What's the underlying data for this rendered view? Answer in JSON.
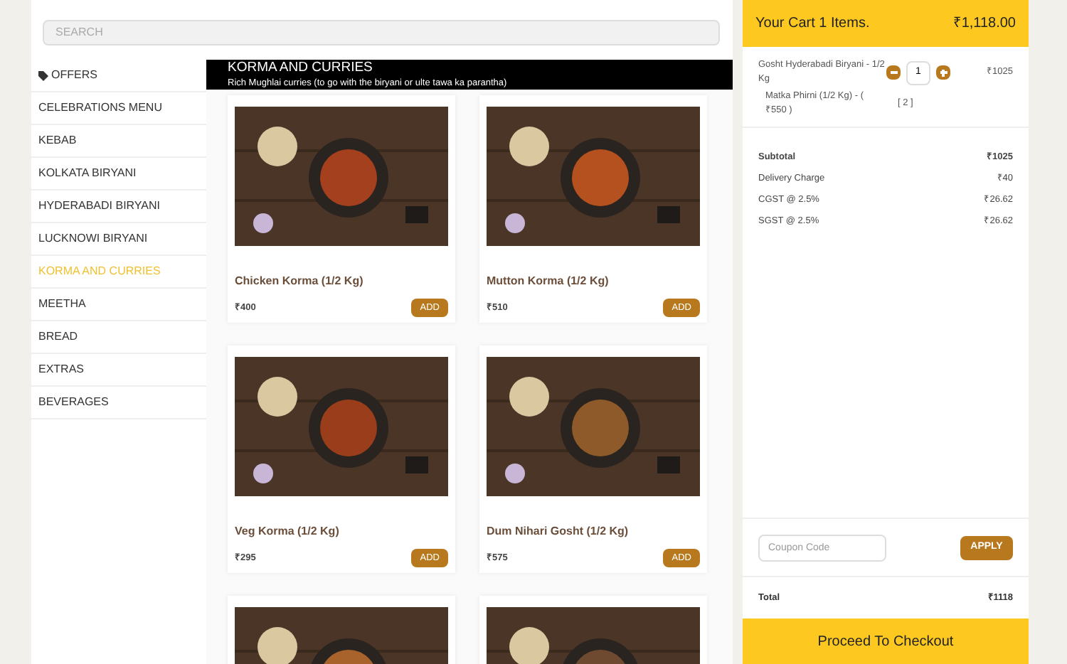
{
  "search": {
    "placeholder": "SEARCH"
  },
  "sidebar": {
    "items": [
      {
        "label": "OFFERS",
        "kind": "tag",
        "selected": false
      },
      {
        "label": "CELEBRATIONS MENU",
        "kind": "plain",
        "selected": false
      },
      {
        "label": "KEBAB",
        "kind": "plain",
        "selected": false
      },
      {
        "label": "KOLKATA BIRYANI",
        "kind": "plain",
        "selected": false
      },
      {
        "label": "HYDERABADI BIRYANI",
        "kind": "plain",
        "selected": false
      },
      {
        "label": "LUCKNOWI BIRYANI",
        "kind": "plain",
        "selected": false
      },
      {
        "label": "KORMA AND CURRIES",
        "kind": "plain",
        "selected": true
      },
      {
        "label": "MEETHA",
        "kind": "plain",
        "selected": false
      },
      {
        "label": "BREAD",
        "kind": "plain",
        "selected": false
      },
      {
        "label": "EXTRAS",
        "kind": "plain",
        "selected": false
      },
      {
        "label": "BEVERAGES",
        "kind": "plain",
        "selected": false
      }
    ]
  },
  "section": {
    "title": "KORMA AND CURRIES",
    "subtitle": "Rich Mughlai curries (to go with the biryani or ulte tawa ka parantha)"
  },
  "products": [
    {
      "kind": "full",
      "name": "Chicken Korma (1/2 Kg)",
      "price": "₹400",
      "button": "ADD"
    },
    {
      "kind": "full",
      "name": "Mutton Korma (1/2 Kg)",
      "price": "₹510",
      "button": "ADD"
    },
    {
      "kind": "full",
      "name": "Veg Korma (1/2 Kg)",
      "price": "₹295",
      "button": "ADD"
    },
    {
      "kind": "full",
      "name": "Dum Nihari Gosht (1/2 Kg)",
      "price": "₹575",
      "button": "ADD"
    },
    {
      "kind": "image_only"
    },
    {
      "kind": "image_only"
    }
  ],
  "cart": {
    "title": "Your Cart 1 Items.",
    "total_header": "₹1,118.00",
    "items": [
      {
        "name": "Gosht Hyderabadi Biryani - 1/2 Kg",
        "quantity": "1",
        "price": "₹1025",
        "addon": "Matka Phirni (1/2 Kg) - ( ₹550 )",
        "addon_qty": "[ 2 ]"
      }
    ],
    "summary": [
      {
        "label": "Subtotal",
        "value": "₹1025",
        "bold": true
      },
      {
        "label": "Delivery Charge",
        "value": "₹40",
        "bold": false
      },
      {
        "label": "CGST @ 2.5%",
        "value": "₹26.62",
        "bold": false
      },
      {
        "label": "SGST @ 2.5%",
        "value": "₹26.62",
        "bold": false
      }
    ],
    "coupon": {
      "placeholder": "Coupon Code",
      "button": "APPLY"
    },
    "total": {
      "label": "Total",
      "value": "₹1118"
    },
    "checkout": "Proceed To Checkout"
  }
}
